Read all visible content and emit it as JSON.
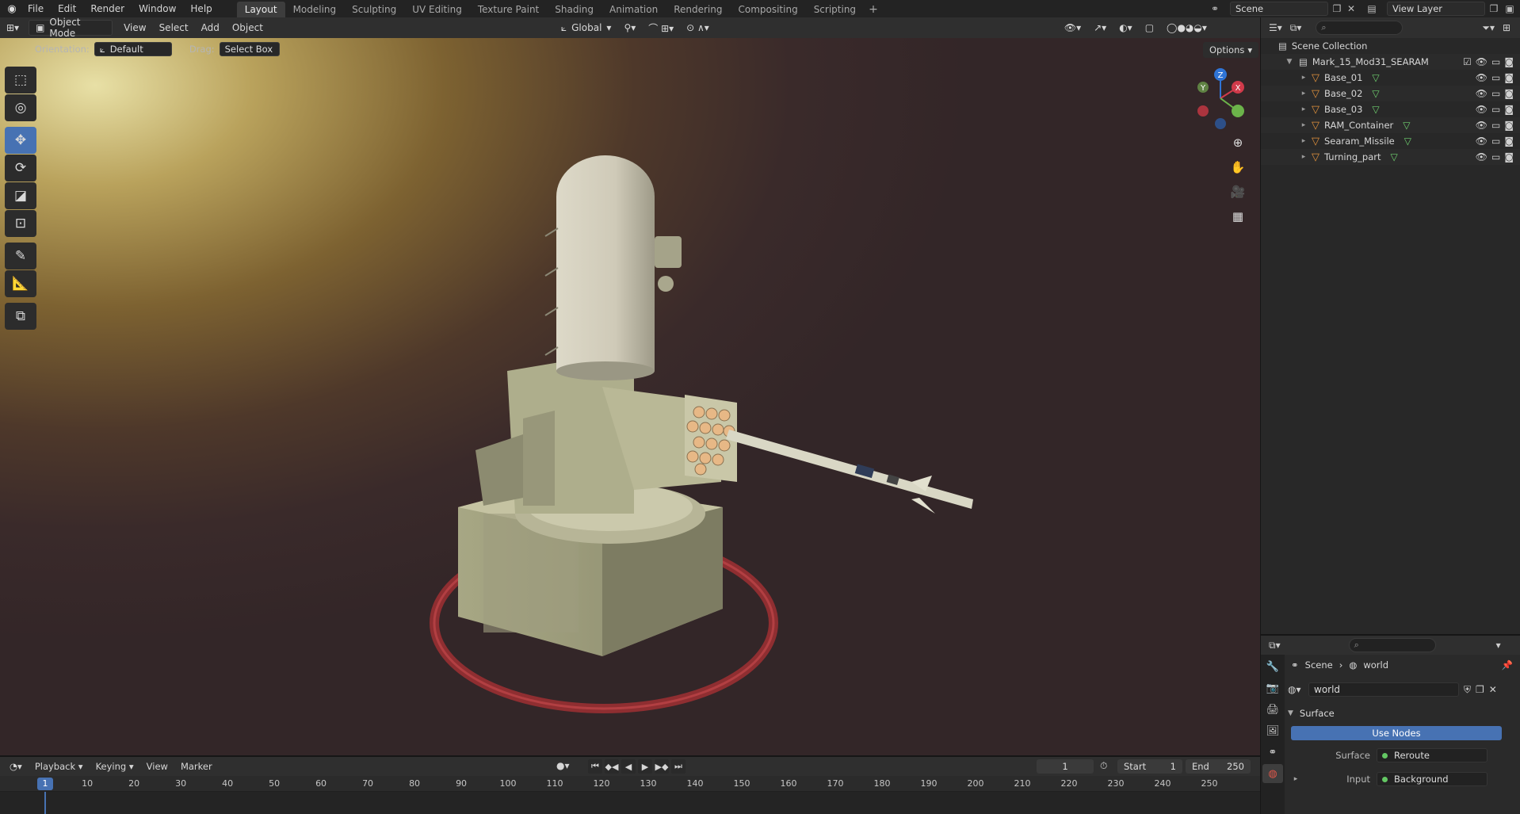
{
  "menu": {
    "items": [
      "File",
      "Edit",
      "Render",
      "Window",
      "Help"
    ]
  },
  "workspaces": {
    "tabs": [
      "Layout",
      "Modeling",
      "Sculpting",
      "UV Editing",
      "Texture Paint",
      "Shading",
      "Animation",
      "Rendering",
      "Compositing",
      "Scripting"
    ],
    "add": "+"
  },
  "scene": {
    "name": "Scene"
  },
  "view_layer": {
    "name": "View Layer"
  },
  "viewport_header": {
    "mode": "Object Mode",
    "menus": [
      "View",
      "Select",
      "Add",
      "Object"
    ],
    "transform": "Global"
  },
  "tool_settings": {
    "orientation_label": "Orientation:",
    "orientation_value": "Default",
    "drag_label": "Drag:",
    "drag_value": "Select Box",
    "options": "Options"
  },
  "gizmo": {
    "z": "Z",
    "y": "Y",
    "x": "X"
  },
  "outliner": {
    "root": "Scene Collection",
    "collection": "Mark_15_Mod31_SEARAM",
    "objects": [
      {
        "name": "Base_01"
      },
      {
        "name": "Base_02"
      },
      {
        "name": "Base_03"
      },
      {
        "name": "RAM_Container"
      },
      {
        "name": "Searam_Missile"
      },
      {
        "name": "Turning_part"
      }
    ]
  },
  "properties": {
    "breadcrumb_scene": "Scene",
    "breadcrumb_world": "world",
    "world_name": "world",
    "panel": "Surface",
    "use_nodes": "Use Nodes",
    "surface_label": "Surface",
    "surface_value": "Reroute",
    "input_label": "Input",
    "input_value": "Background"
  },
  "timeline": {
    "menus": [
      "Playback",
      "Keying",
      "View",
      "Marker"
    ],
    "current_frame": "1",
    "start_label": "Start",
    "start_value": "1",
    "end_label": "End",
    "end_value": "250",
    "ticks": [
      "10",
      "20",
      "30",
      "40",
      "50",
      "60",
      "70",
      "80",
      "90",
      "100",
      "110",
      "120",
      "130",
      "140",
      "150",
      "160",
      "170",
      "180",
      "190",
      "200",
      "210",
      "220",
      "230",
      "240",
      "250"
    ],
    "cursor": "1"
  },
  "colors": {
    "accent": "#4772b3",
    "object_icon": "#e0913d",
    "mesh_icon": "#6fd06f"
  }
}
